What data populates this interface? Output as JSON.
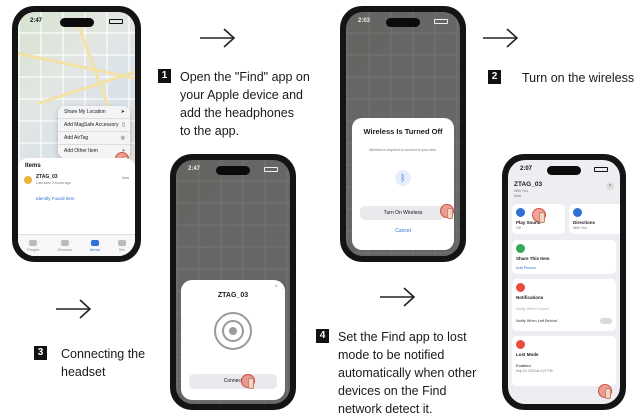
{
  "steps": [
    {
      "num": "1",
      "lines": [
        "Open the \"Find\" app on",
        "your Apple device and",
        "add the headphones",
        "to the app."
      ]
    },
    {
      "num": "2",
      "lines": [
        "Turn on the wireless"
      ]
    },
    {
      "num": "3",
      "lines": [
        "Connecting the",
        "headset"
      ]
    },
    {
      "num": "4",
      "lines": [
        "Set the Find app to lost",
        "mode to be notified",
        "automatically when other",
        "devices on the Find",
        "network detect it."
      ]
    }
  ],
  "phone1": {
    "time": "2:47",
    "menu": [
      "Share My Location",
      "Add MagSafe Accessory",
      "Add AirTag",
      "Add Other Item"
    ],
    "items_header": "Items",
    "item_name": "ZTAG_03",
    "item_sub": "Last seen 2 hours ago",
    "item_time": "Now",
    "identify_link": "Identify Found Item",
    "tabs": [
      "People",
      "Devices",
      "Items",
      "Me"
    ]
  },
  "phone2": {
    "time": "2:03",
    "title": "Wireless Is Turned Off",
    "subtitle": "Wireless is required to connect to your item.",
    "primary_button": "Turn On Wireless",
    "cancel": "Cancel"
  },
  "phone3": {
    "time": "2:47",
    "device_name": "ZTAG_03",
    "connect_button": "Connect"
  },
  "phone4": {
    "time": "2:07",
    "item_name": "ZTAG_03",
    "item_sub": "With You",
    "item_sub2": "Now",
    "actions": [
      {
        "label": "Play Sound",
        "sub": "Off"
      },
      {
        "label": "Directions",
        "sub": "With You"
      }
    ],
    "share_title": "Share This Item",
    "add_person": "Add Person",
    "notifications": "Notifications",
    "notify_when_found": "Notify When Found",
    "notify_when_left": "Notify When Left Behind",
    "lost_mode": "Lost Mode",
    "enabled": "Enabled",
    "enabled_sub": "Sep 10, 2024 at 2:07 PM"
  },
  "colors": {
    "accent": "#2f6fd6",
    "tap": "#e65a46"
  }
}
